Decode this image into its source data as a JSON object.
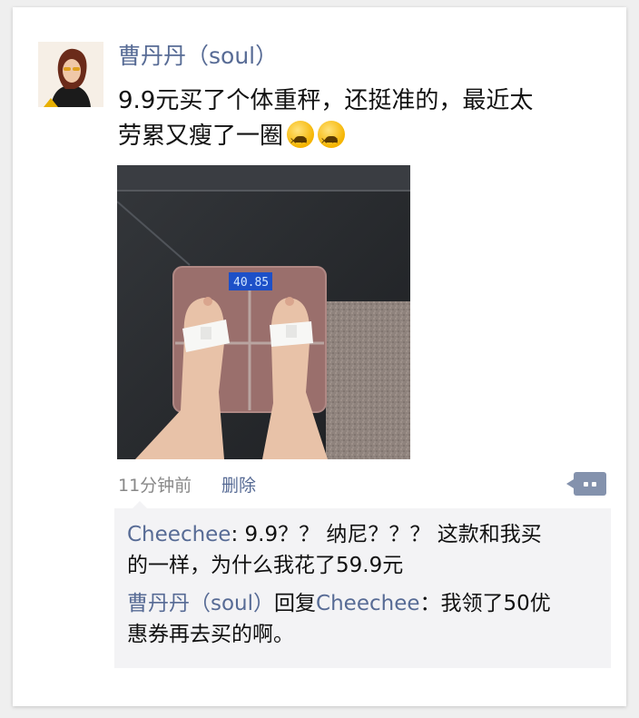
{
  "post": {
    "username": "曹丹丹（soul）",
    "text_line1": "9.9元买了个体重秤，还挺准的，最近太",
    "text_line2": "劳累又瘦了一圈",
    "emojis": [
      "tired-face-emoji",
      "tired-face-emoji"
    ],
    "scale_display": "40.85",
    "time": "11分钟前",
    "delete_label": "删除"
  },
  "comments": [
    {
      "author": "Cheechee",
      "sep": ": ",
      "text_line1": "9.9？？ 纳尼？？？ 这款和我买",
      "text_line2": "的一样，为什么我花了59.9元"
    },
    {
      "author": "曹丹丹（soul）",
      "reply_word": "回复",
      "reply_to": "Cheechee",
      "sep": "：",
      "text_line1": "我领了50优",
      "text_line2": "惠券再去买的啊。"
    }
  ],
  "colors": {
    "link": "#576b95",
    "comment_bg": "#f3f3f5",
    "card_bg": "#ffffff"
  }
}
